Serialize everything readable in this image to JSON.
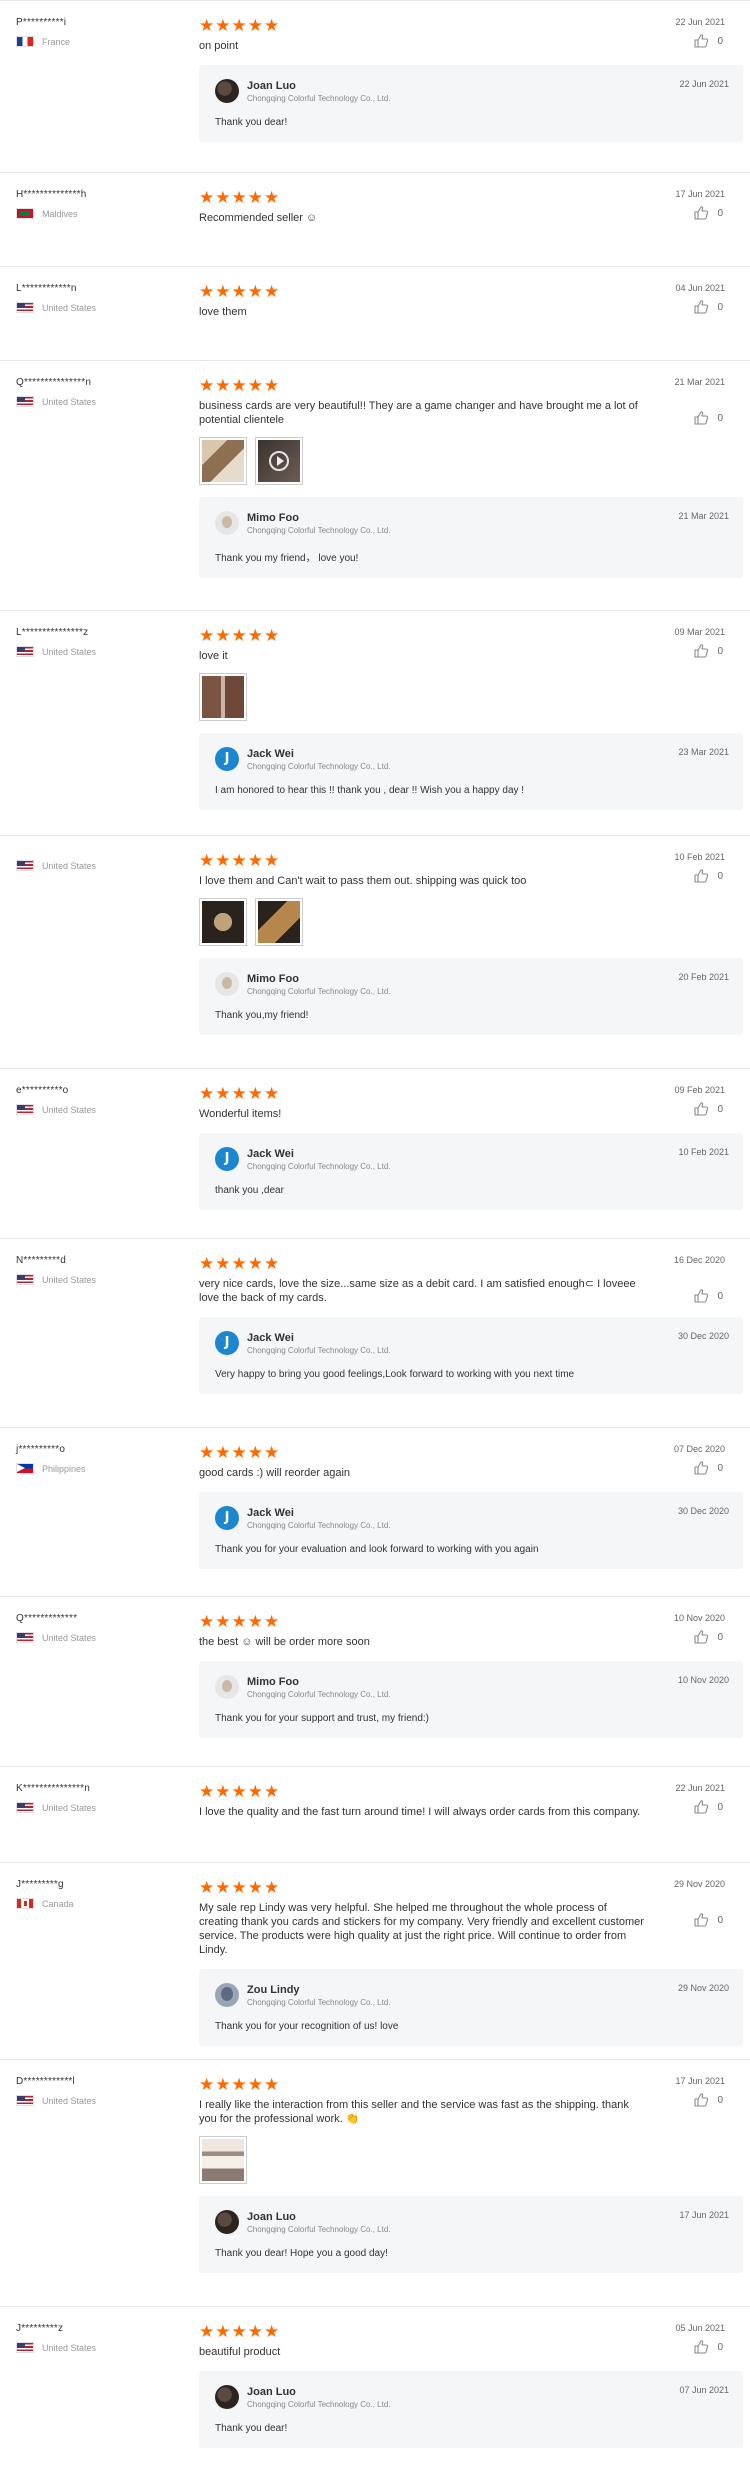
{
  "seller_company": "Chongqing Colorful Technology Co., Ltd.",
  "colors": {
    "star": "#ff6a00",
    "reply_bg": "#f5f6f8",
    "divider": "#e8e8e8"
  },
  "reviews": [
    {
      "buyer": "P**********i",
      "country": "France",
      "flag": "fr",
      "stars": 5,
      "date": "22 Jun 2021",
      "text": "on point",
      "likes": "0",
      "photos": [],
      "reply": {
        "name": "Joan Luo",
        "avatar": "joan",
        "date": "22 Jun 2021",
        "text": "Thank you dear!"
      }
    },
    {
      "buyer": "H**************h",
      "country": "Maldives",
      "flag": "mv",
      "stars": 5,
      "date": "17 Jun 2021",
      "text": "Recommended seller ☺",
      "likes": "0",
      "photos": [],
      "reply": null
    },
    {
      "buyer": "L************n",
      "country": "United States",
      "flag": "us",
      "stars": 5,
      "date": "04 Jun 2021",
      "text": "love them",
      "likes": "0",
      "photos": [],
      "reply": null
    },
    {
      "buyer": "Q***************n",
      "country": "United States",
      "flag": "us",
      "stars": 5,
      "date": "21 Mar 2021",
      "text": "business cards are very beautiful!! They are a game changer and have brought me a lot of potential clientele",
      "likes": "0",
      "photos": [
        "card",
        "video"
      ],
      "reply": {
        "name": "Mimo Foo",
        "avatar": "mimo",
        "date": "21 Mar 2021",
        "text": "Thank you my friend， love you!"
      }
    },
    {
      "buyer": "L***************z",
      "country": "United States",
      "flag": "us",
      "stars": 5,
      "date": "09 Mar 2021",
      "text": "love it",
      "likes": "0",
      "photos": [
        "door"
      ],
      "reply": {
        "name": "Jack Wei",
        "avatar": "jack",
        "date": "23 Mar 2021",
        "text": "I am honored to hear this !! thank you , dear !! Wish you a happy day !"
      }
    },
    {
      "buyer": "",
      "country": "United States",
      "flag": "us",
      "stars": 5,
      "date": "10 Feb 2021",
      "text": "I love them and Can't wait to pass them out. shipping was quick too",
      "likes": "0",
      "photos": [
        "cards1",
        "cards2"
      ],
      "reply": {
        "name": "Mimo Foo",
        "avatar": "mimo",
        "date": "20 Feb 2021",
        "text": "Thank you,my friend!"
      }
    },
    {
      "buyer": "e**********o",
      "country": "United States",
      "flag": "us",
      "stars": 5,
      "date": "09 Feb 2021",
      "text": "Wonderful items!",
      "likes": "0",
      "photos": [],
      "reply": {
        "name": "Jack Wei",
        "avatar": "jack",
        "date": "10 Feb 2021",
        "text": "thank you ,dear"
      }
    },
    {
      "buyer": "N*********d",
      "country": "United States",
      "flag": "us",
      "stars": 5,
      "date": "16 Dec 2020",
      "text": "very nice cards, love the size...same size as a debit card.  I am satisfied enough⊂ I loveee love the back of my cards.",
      "likes": "0",
      "photos": [],
      "reply": {
        "name": "Jack Wei",
        "avatar": "jack",
        "date": "30 Dec 2020",
        "text": "Very happy to bring you good feelings,Look forward to working with you next time"
      }
    },
    {
      "buyer": "j**********o",
      "country": "Philippines",
      "flag": "ph",
      "stars": 5,
      "date": "07 Dec 2020",
      "text": "good cards :) will reorder again",
      "likes": "0",
      "photos": [],
      "reply": {
        "name": "Jack Wei",
        "avatar": "jack",
        "date": "30 Dec 2020",
        "text": "Thank you for your evaluation and look forward to working with you again"
      }
    },
    {
      "buyer": "Q*************",
      "country": "United States",
      "flag": "us",
      "stars": 5,
      "date": "10 Nov 2020",
      "text": "the best ☺ will be order more soon",
      "likes": "0",
      "photos": [],
      "reply": {
        "name": "Mimo Foo",
        "avatar": "mimo",
        "date": "10 Nov 2020",
        "text": "Thank you for your support and trust, my friend:)"
      }
    },
    {
      "buyer": "K***************n",
      "country": "United States",
      "flag": "us",
      "stars": 5,
      "date": "22 Jun 2021",
      "text": "I love the quality and the fast turn around time! I will always order cards from this company.",
      "likes": "0",
      "photos": [],
      "reply": null
    },
    {
      "buyer": "J*********g",
      "country": "Canada",
      "flag": "ca",
      "stars": 5,
      "date": "29 Nov 2020",
      "text": "My sale rep Lindy was very helpful. She helped me throughout the whole process of creating thank you cards and stickers for my company. Very friendly and excellent customer service. The products were high quality at just the right price. Will continue to order from Lindy.",
      "likes": "0",
      "photos": [],
      "reply": {
        "name": "Zou Lindy",
        "avatar": "zou",
        "date": "29 Nov 2020",
        "text": "Thank you for your recognition of us! love"
      }
    },
    {
      "buyer": "D************l",
      "country": "United States",
      "flag": "us",
      "stars": 5,
      "date": "17 Jun 2021",
      "text": "I really like the interaction from this seller and the service was fast as the shipping. thank you for the professional work. 👏",
      "likes": "0",
      "photos": [
        "stack"
      ],
      "reply": {
        "name": "Joan Luo",
        "avatar": "joan",
        "date": "17 Jun 2021",
        "text": "Thank you dear! Hope you a  good day!"
      }
    },
    {
      "buyer": "J*********z",
      "country": "United States",
      "flag": "us",
      "stars": 5,
      "date": "05 Jun 2021",
      "text": "beautiful product",
      "likes": "0",
      "photos": [],
      "reply": {
        "name": "Joan Luo",
        "avatar": "joan",
        "date": "07 Jun 2021",
        "text": "Thank you dear!"
      }
    }
  ]
}
